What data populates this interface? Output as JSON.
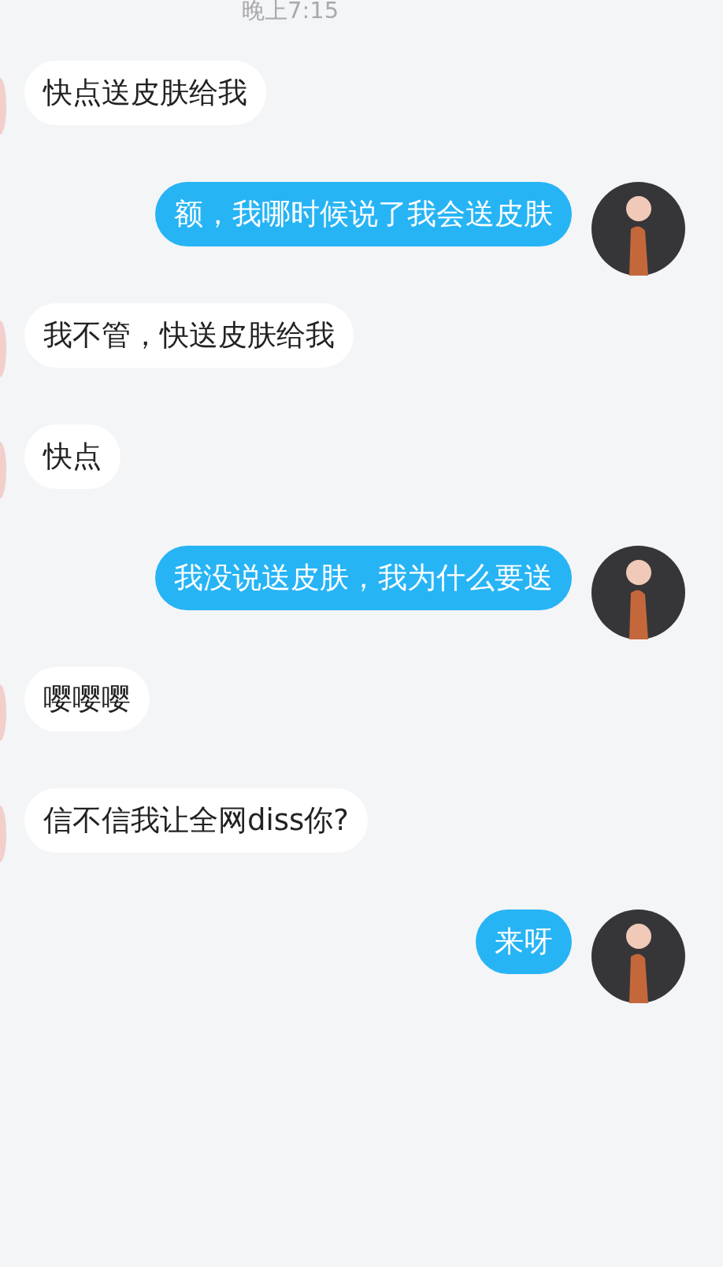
{
  "timestamp": "晚上7:15",
  "messages": [
    {
      "kind": "received",
      "text": "快点送皮肤给我"
    },
    {
      "kind": "sent",
      "text": "额，我哪时候说了我会送皮肤"
    },
    {
      "kind": "received",
      "text": "我不管，快送皮肤给我"
    },
    {
      "kind": "received",
      "text": "快点"
    },
    {
      "kind": "sent",
      "text": "我没说送皮肤，我为什么要送"
    },
    {
      "kind": "received",
      "text": "嘤嘤嘤"
    },
    {
      "kind": "received",
      "text": "信不信我让全网diss你?"
    },
    {
      "kind": "sent",
      "text": "来呀"
    }
  ]
}
